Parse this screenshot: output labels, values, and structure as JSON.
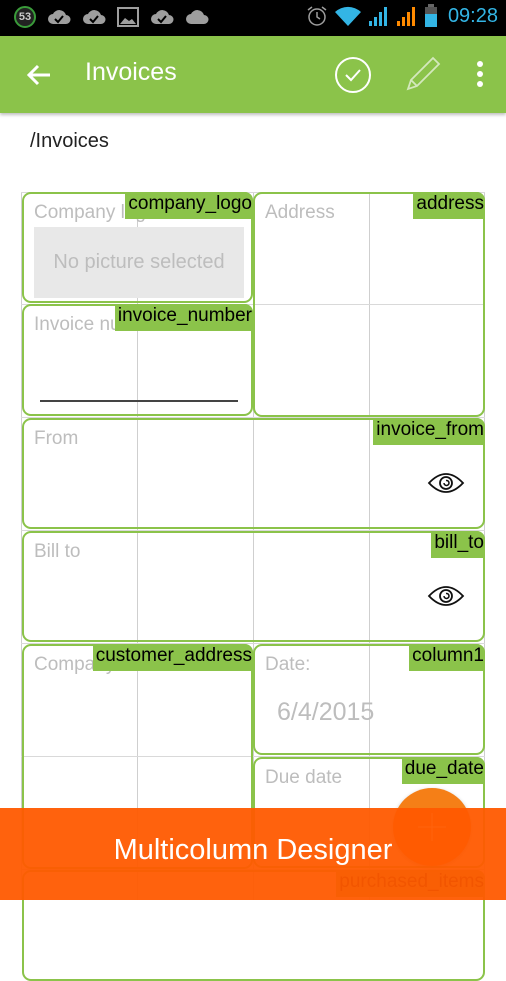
{
  "status_bar": {
    "notification_count": "53",
    "left_icons": [
      "cloud-check-icon",
      "cloud-check-icon",
      "image-icon",
      "cloud-check-icon",
      "cloud-icon"
    ],
    "right_icons": [
      "alarm-icon",
      "wifi-icon",
      "signal-blue-icon",
      "signal-orange-icon",
      "battery-icon"
    ],
    "time": "09:28",
    "colors": {
      "time": "#33b5e5",
      "badge_ring": "#3a9b3a"
    }
  },
  "app_bar": {
    "title": "Invoices",
    "back_icon": "arrow-left-icon",
    "actions": [
      "check-circle-icon",
      "pencil-icon",
      "more-vert-icon"
    ],
    "color": "#8bc34a"
  },
  "breadcrumb": "/Invoices",
  "designer": {
    "fields": [
      {
        "id": "company_logo",
        "hint": "Company logo",
        "placeholder": "No picture selected"
      },
      {
        "id": "address",
        "hint": "Address"
      },
      {
        "id": "invoice_number",
        "hint": "Invoice number"
      },
      {
        "id": "invoice_from",
        "hint": "From",
        "icon": "eye-icon"
      },
      {
        "id": "bill_to",
        "hint": "Bill to",
        "icon": "eye-icon"
      },
      {
        "id": "customer_address",
        "hint": "Company"
      },
      {
        "id": "column1",
        "hint": "Date:",
        "value": "6/4/2015"
      },
      {
        "id": "due_date",
        "hint": "Due date"
      },
      {
        "id": "purchased_items",
        "hint": ""
      }
    ],
    "field_border_color": "#8bc34a"
  },
  "fab": {
    "icon": "plus-icon",
    "color": "#f57f17"
  },
  "banner": {
    "text": "Multicolumn Designer",
    "color": "#ff5a00"
  }
}
